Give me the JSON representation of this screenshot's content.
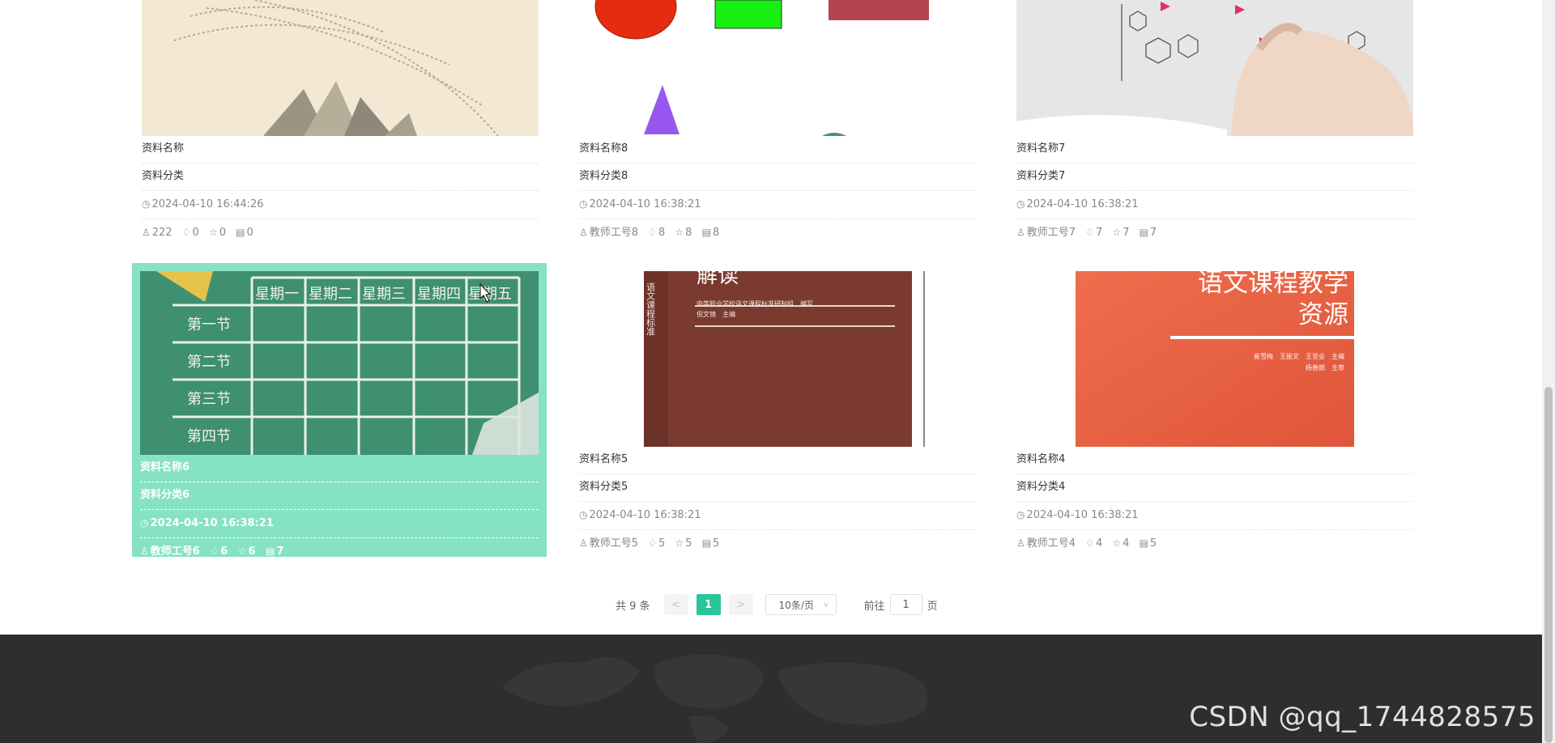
{
  "cards": [
    {
      "name": "资料名称",
      "category": "资料分类",
      "time": "2024-04-10 16:44:26",
      "author": "222",
      "likes": "0",
      "favorites": "0",
      "comments": "0"
    },
    {
      "name": "资料名称8",
      "category": "资料分类8",
      "time": "2024-04-10 16:38:21",
      "author": "教师工号8",
      "likes": "8",
      "favorites": "8",
      "comments": "8"
    },
    {
      "name": "资料名称7",
      "category": "资料分类7",
      "time": "2024-04-10 16:38:21",
      "author": "教师工号7",
      "likes": "7",
      "favorites": "7",
      "comments": "7"
    },
    {
      "name": "资料名称6",
      "category": "资料分类6",
      "time": "2024-04-10 16:38:21",
      "author": "教师工号6",
      "likes": "6",
      "favorites": "6",
      "comments": "7"
    },
    {
      "name": "资料名称5",
      "category": "资料分类5",
      "time": "2024-04-10 16:38:21",
      "author": "教师工号5",
      "likes": "5",
      "favorites": "5",
      "comments": "5"
    },
    {
      "name": "资料名称4",
      "category": "资料分类4",
      "time": "2024-04-10 16:38:21",
      "author": "教师工号4",
      "likes": "4",
      "favorites": "4",
      "comments": "5"
    }
  ],
  "timetable": {
    "days": [
      "星期一",
      "星期二",
      "星期三",
      "星期四",
      "星期五"
    ],
    "periods": [
      "第一节",
      "第二节",
      "第三节",
      "第四节"
    ]
  },
  "book5": {
    "title": "解读",
    "spine": "语文课程标准",
    "publisher": "中等职业学校语文课程标准研制组　编写",
    "editor": "倪文锦　主编"
  },
  "book4": {
    "title": "语文课程教学",
    "subtitle": "资源",
    "authors": "崔雪梅　王振文　王坚业　主编",
    "reviewer": "杨善朗　主审"
  },
  "pagination": {
    "total": "共 9 条",
    "prev": "<",
    "current": "1",
    "next": ">",
    "page_size": "10条/页",
    "goto_prefix": "前往",
    "goto_value": "1",
    "goto_suffix": "页"
  },
  "watermark": "CSDN @qq_1744828575",
  "colors": {
    "accent": "#2bc59b",
    "hover_bg": "#86e2c4",
    "footer": "#2e2e2e"
  }
}
